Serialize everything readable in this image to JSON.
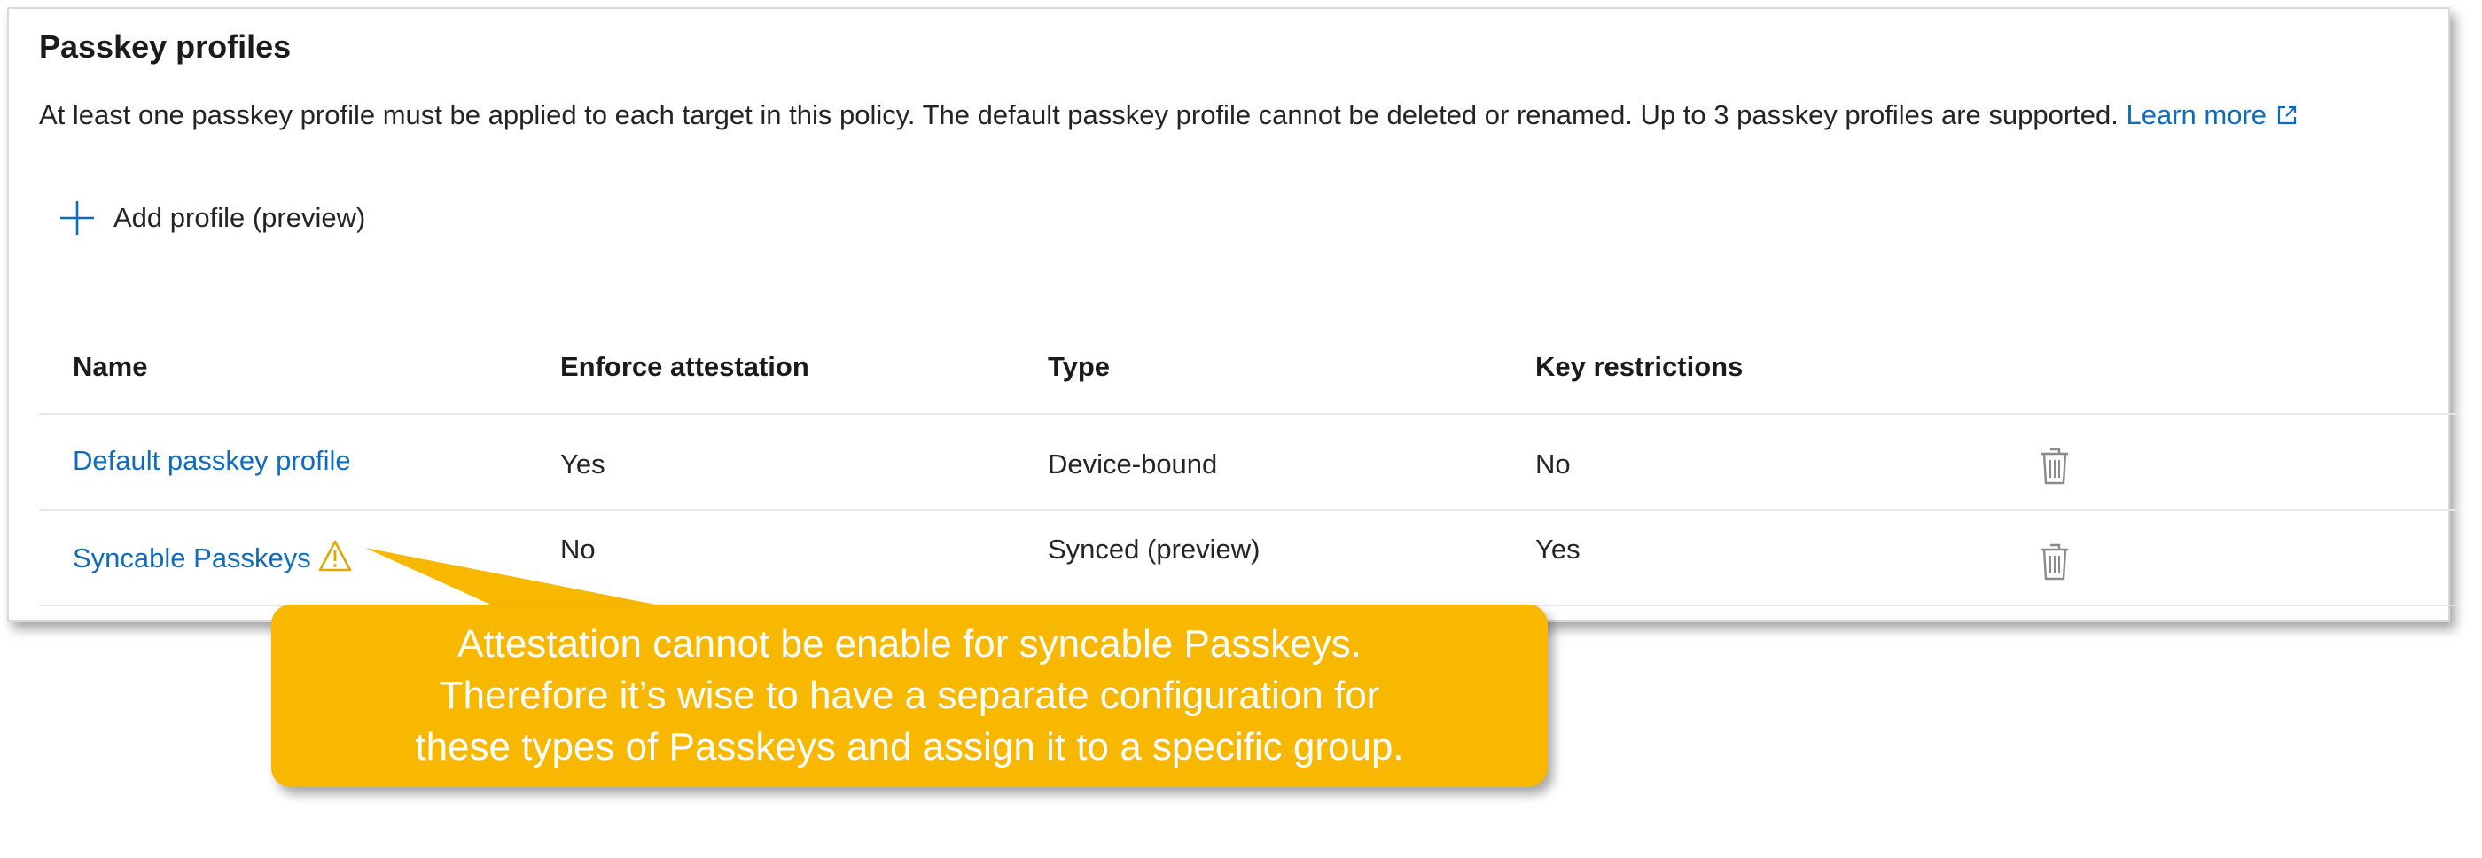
{
  "panel": {
    "title": "Passkey profiles",
    "description": "At least one passkey profile must be applied to each target in this policy. The default passkey profile cannot be deleted or renamed. Up to 3 passkey profiles are supported.",
    "learn_more": "Learn more",
    "add_profile": "Add profile (preview)"
  },
  "table": {
    "headers": [
      "Name",
      "Enforce attestation",
      "Type",
      "Key restrictions"
    ],
    "rows": [
      {
        "name": "Default passkey profile",
        "attestation": "Yes",
        "type": "Device-bound",
        "restrictions": "No",
        "warning": false
      },
      {
        "name": "Syncable Passkeys",
        "attestation": "No",
        "type": "Synced (preview)",
        "restrictions": "Yes",
        "warning": true
      }
    ]
  },
  "callout": {
    "lines": [
      "Attestation cannot be enable for syncable Passkeys.",
      "Therefore it’s wise to have a separate configuration for",
      "these types of Passkeys and assign it to a specific group."
    ]
  },
  "colors": {
    "link": "#0f6cbd",
    "callout": "#f8b800",
    "warning": "#e0a800",
    "icon_gray": "#8a8a8a"
  },
  "icons": [
    "external-link-icon",
    "plus-icon",
    "trash-icon",
    "warning-icon"
  ]
}
